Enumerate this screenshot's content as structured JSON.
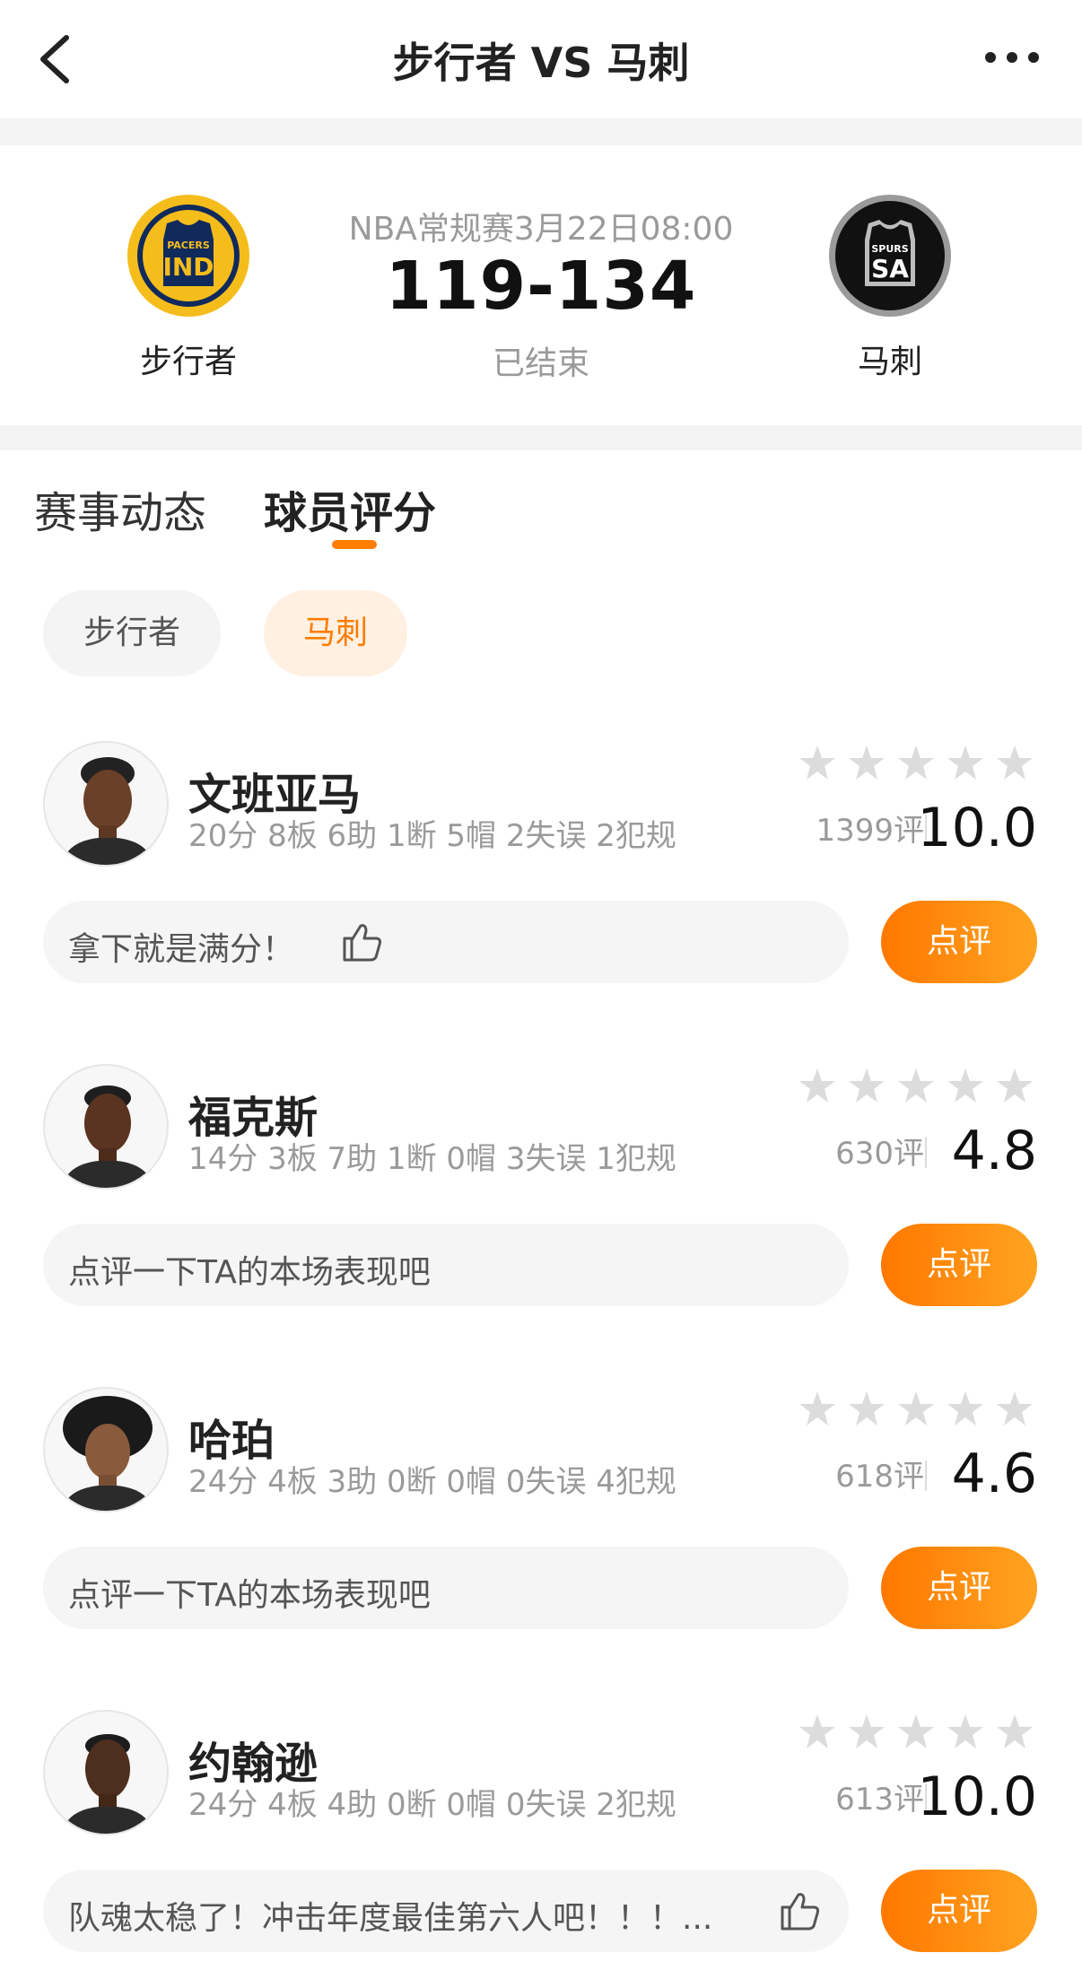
{
  "header": {
    "title": "步行者 VS 马刺"
  },
  "match": {
    "home": {
      "name": "步行者",
      "logo_top": "PACERS",
      "logo_abbr": "IND"
    },
    "away": {
      "name": "马刺",
      "logo_top": "SPURS",
      "logo_abbr": "SA"
    },
    "info": "NBA常规赛3月22日08:00",
    "score": "119-134",
    "status": "已结束"
  },
  "tabs": [
    "赛事动态",
    "球员评分"
  ],
  "team_toggle": [
    "步行者",
    "马刺"
  ],
  "review_label": "点评",
  "colors": {
    "accent": "#ff7d00",
    "pacers_navy": "#112a5c",
    "pacers_gold": "#f5bd1c",
    "spurs_black": "#111111"
  },
  "players": [
    {
      "name": "文班亚马",
      "stats": "20分 8板 6助 1断 5帽 2失误 2犯规",
      "ratings": "1399评",
      "score": "10.0",
      "comment": "拿下就是满分！"
    },
    {
      "name": "福克斯",
      "stats": "14分 3板 7助 1断 0帽 3失误 1犯规",
      "ratings": "630评",
      "score": "4.8",
      "comment": "点评一下TA的本场表现吧"
    },
    {
      "name": "哈珀",
      "stats": "24分 4板 3助 0断 0帽 0失误 4犯规",
      "ratings": "618评",
      "score": "4.6",
      "comment": "点评一下TA的本场表现吧"
    },
    {
      "name": "约翰逊",
      "stats": "24分 4板 4助 0断 0帽 0失误 2犯规",
      "ratings": "613评",
      "score": "10.0",
      "comment": "队魂太稳了！冲击年度最佳第六人吧！！！..."
    }
  ]
}
